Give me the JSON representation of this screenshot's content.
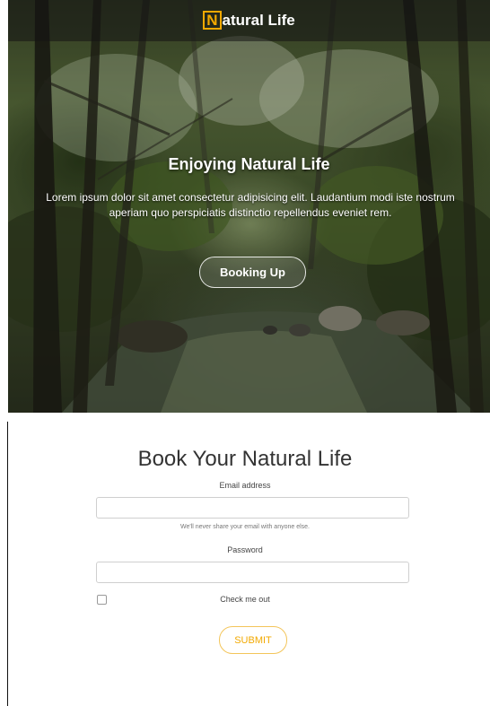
{
  "header": {
    "brand_letter": "N",
    "brand_rest": "atural Life"
  },
  "hero": {
    "title": "Enjoying Natural Life",
    "text": "Lorem ipsum dolor sit amet consectetur adipisicing elit. Laudantium modi iste nostrum aperiam quo perspiciatis distinctio repellendus eveniet rem.",
    "button_label": "Booking Up"
  },
  "form": {
    "title": "Book Your Natural Life",
    "email_label": "Email address",
    "email_value": "",
    "email_help": "We'll never share your email with anyone else.",
    "password_label": "Password",
    "password_value": "",
    "checkbox_label": "Check me out",
    "checkbox_checked": false,
    "submit_label": "SUBMIT"
  },
  "colors": {
    "accent": "#f2a900",
    "text": "#333333"
  }
}
